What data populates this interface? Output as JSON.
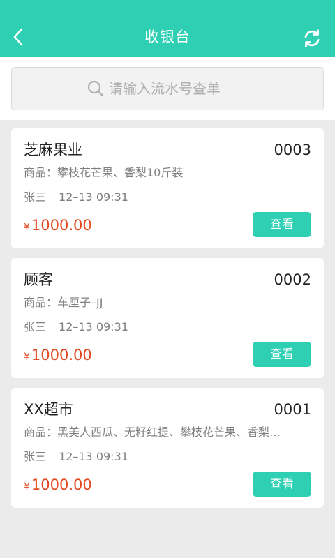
{
  "header": {
    "title": "收银台",
    "back_icon": "chevron-left-icon",
    "refresh_icon": "refresh-icon"
  },
  "search": {
    "placeholder": "请输入流水号查单",
    "icon": "search-icon"
  },
  "colors": {
    "accent": "#2ecfb3",
    "price": "#e24b22",
    "background": "#ebebeb"
  },
  "orders": [
    {
      "customer": "芝麻果业",
      "serial": "0003",
      "goods": "商品：攀枝花芒果、香梨10斤装",
      "operator": "张三",
      "time": "12–13 09:31",
      "currency": "¥",
      "amount": "1000.00",
      "action_label": "查看"
    },
    {
      "customer": "顾客",
      "serial": "0002",
      "goods": "商品：车厘子–JJ",
      "operator": "张三",
      "time": "12–13 09:31",
      "currency": "¥",
      "amount": "1000.00",
      "action_label": "查看"
    },
    {
      "customer": "XX超市",
      "serial": "0001",
      "goods": "商品：黑美人西瓜、无籽红提、攀枝花芒果、香梨…",
      "operator": "张三",
      "time": "12–13 09:31",
      "currency": "¥",
      "amount": "1000.00",
      "action_label": "查看"
    }
  ]
}
